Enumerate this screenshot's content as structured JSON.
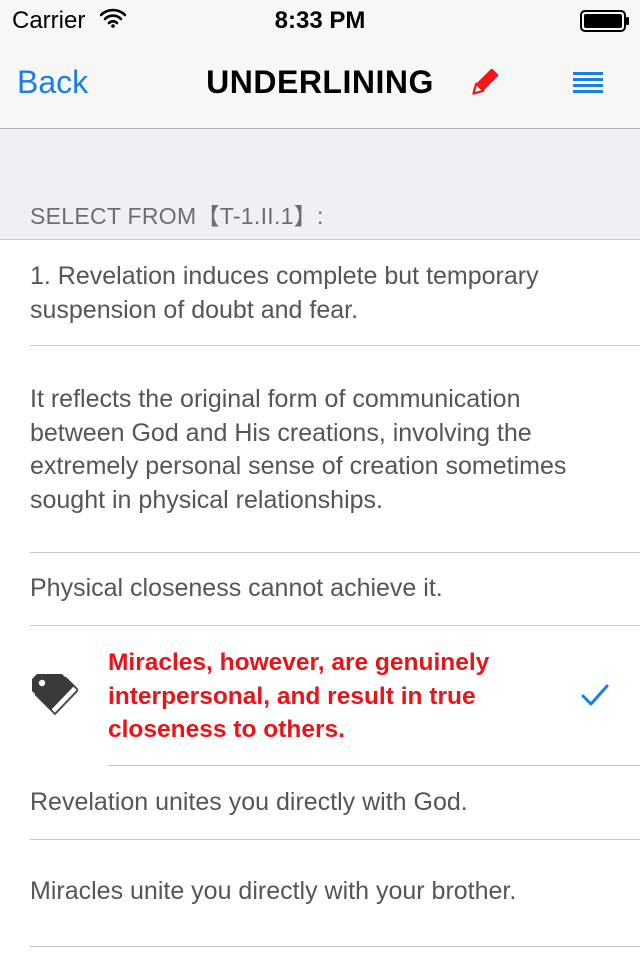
{
  "status_bar": {
    "carrier": "Carrier",
    "time": "8:33 PM",
    "icons": [
      "wifi-icon",
      "battery-icon"
    ]
  },
  "nav_bar": {
    "back_label": "Back",
    "title": "UNDERLINING",
    "icons": [
      "pencil-icon",
      "menu-icon"
    ]
  },
  "colors": {
    "accent": "#1a7ee6",
    "highlight": "#e8141a",
    "background": "#efeff4"
  },
  "section": {
    "header": "SELECT FROM【T-1.II.1】:"
  },
  "rows": [
    {
      "text": "1. Revelation induces complete but temporary suspension of doubt and fear.",
      "selected": false
    },
    {
      "text": "It reflects the original form of communication between God and His creations, involving the extremely personal sense of creation sometimes sought in physical  relationships.",
      "selected": false
    },
    {
      "text": "Physical closeness cannot achieve it.",
      "selected": false
    },
    {
      "text": "Miracles, however, are genuinely interpersonal, and result in true closeness to others.",
      "selected": true,
      "icon": "tag-icon",
      "accessory": "checkmark-icon"
    },
    {
      "text": "Revelation unites you directly with God.",
      "selected": false
    },
    {
      "text": "Miracles unite you directly with your brother.",
      "selected": false
    }
  ]
}
